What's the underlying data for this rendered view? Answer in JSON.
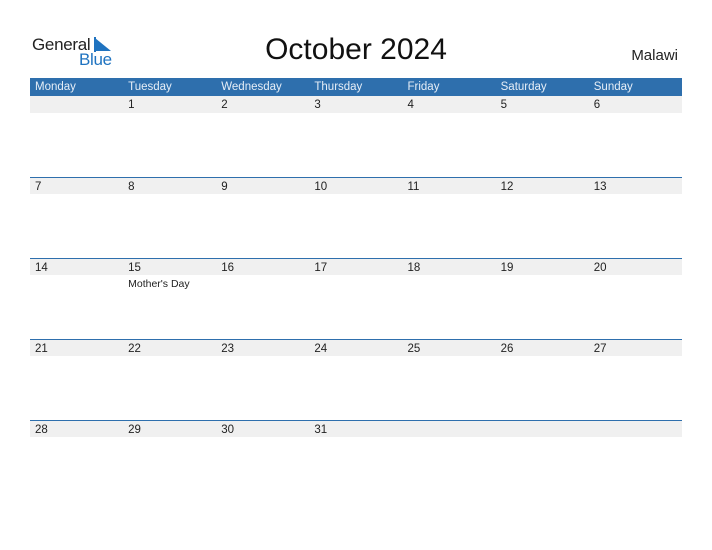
{
  "logo": {
    "line1": "General",
    "line2": "Blue"
  },
  "title": "October 2024",
  "country": "Malawi",
  "colors": {
    "accent": "#2e6fad",
    "logo_blue": "#1f73c0",
    "date_band": "#f0f0f0"
  },
  "weekdays": [
    "Monday",
    "Tuesday",
    "Wednesday",
    "Thursday",
    "Friday",
    "Saturday",
    "Sunday"
  ],
  "weeks": [
    [
      {
        "day": ""
      },
      {
        "day": "1"
      },
      {
        "day": "2"
      },
      {
        "day": "3"
      },
      {
        "day": "4"
      },
      {
        "day": "5"
      },
      {
        "day": "6"
      }
    ],
    [
      {
        "day": "7"
      },
      {
        "day": "8"
      },
      {
        "day": "9"
      },
      {
        "day": "10"
      },
      {
        "day": "11"
      },
      {
        "day": "12"
      },
      {
        "day": "13"
      }
    ],
    [
      {
        "day": "14"
      },
      {
        "day": "15",
        "event": "Mother's Day"
      },
      {
        "day": "16"
      },
      {
        "day": "17"
      },
      {
        "day": "18"
      },
      {
        "day": "19"
      },
      {
        "day": "20"
      }
    ],
    [
      {
        "day": "21"
      },
      {
        "day": "22"
      },
      {
        "day": "23"
      },
      {
        "day": "24"
      },
      {
        "day": "25"
      },
      {
        "day": "26"
      },
      {
        "day": "27"
      }
    ],
    [
      {
        "day": "28"
      },
      {
        "day": "29"
      },
      {
        "day": "30"
      },
      {
        "day": "31"
      },
      {
        "day": ""
      },
      {
        "day": ""
      },
      {
        "day": ""
      }
    ]
  ]
}
